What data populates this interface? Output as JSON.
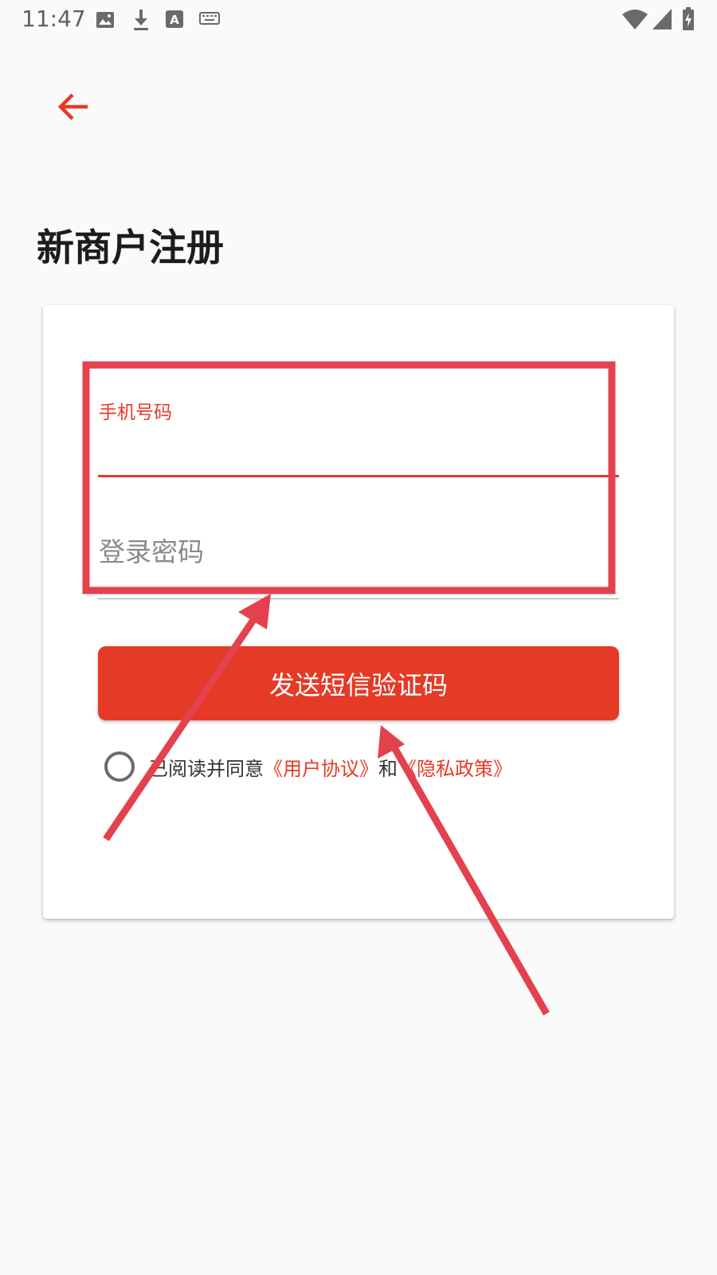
{
  "status_bar": {
    "time": "11:47",
    "icons": [
      "image-icon",
      "download-icon",
      "font-a-icon",
      "keyboard-icon",
      "wifi-icon",
      "signal-icon",
      "battery-charging-icon"
    ]
  },
  "header": {
    "back_icon": "arrow-left-icon",
    "title": "新商户注册"
  },
  "form": {
    "phone_label": "手机号码",
    "phone_value": "",
    "password_placeholder": "登录密码",
    "password_value": "",
    "send_button_label": "发送短信验证码"
  },
  "agreement": {
    "checked": false,
    "prefix": "已阅读并同意",
    "user_agreement_link": "《用户协议》",
    "conjunction": "和",
    "privacy_policy_link": "《隐私政策》"
  },
  "colors": {
    "accent": "#e53a25",
    "annotation": "#e3414d",
    "background": "#fafafa"
  }
}
